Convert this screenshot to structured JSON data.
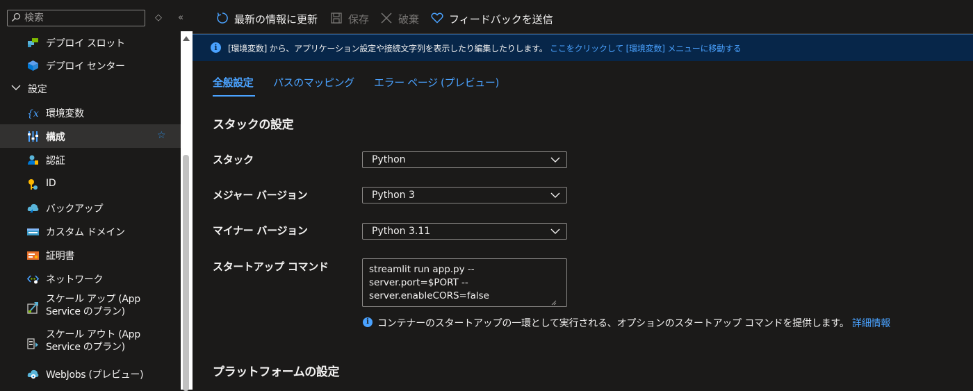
{
  "search": {
    "placeholder": "検索",
    "value": ""
  },
  "sidebar_controls": {
    "sort_glyph": "◇",
    "collapse_glyph": "«"
  },
  "sidebar": {
    "items": [
      {
        "label": "デプロイ スロット",
        "icon": "deployment-slots-icon"
      },
      {
        "label": "デプロイ センター",
        "icon": "deployment-center-icon"
      },
      {
        "label": "設定",
        "icon": "chevron-down-icon",
        "group": true
      },
      {
        "label": "環境変数",
        "icon": "environment-variables-icon"
      },
      {
        "label": "構成",
        "icon": "configuration-icon",
        "selected": true
      },
      {
        "label": "認証",
        "icon": "authentication-icon"
      },
      {
        "label": "ID",
        "icon": "identity-icon"
      },
      {
        "label": "バックアップ",
        "icon": "backup-icon"
      },
      {
        "label": "カスタム ドメイン",
        "icon": "custom-domain-icon"
      },
      {
        "label": "証明書",
        "icon": "certificate-icon"
      },
      {
        "label": "ネットワーク",
        "icon": "network-icon"
      },
      {
        "label": "スケール アップ (App Service のプラン)",
        "icon": "scale-up-icon"
      },
      {
        "label": "スケール アウト (App Service のプラン)",
        "icon": "scale-out-icon"
      },
      {
        "label": "WebJobs (プレビュー)",
        "icon": "webjobs-icon"
      }
    ],
    "favorite_glyph": "☆"
  },
  "toolbar": {
    "refresh_label": "最新の情報に更新",
    "save_label": "保存",
    "discard_label": "破棄",
    "feedback_label": "フィードバックを送信"
  },
  "infobar": {
    "text": "[環境変数] から、アプリケーション設定や接続文字列を表示したり編集したりします。",
    "link": "ここをクリックして [環境変数] メニューに移動する",
    "icon_glyph": "i"
  },
  "tabs": [
    {
      "label": "全般設定",
      "active": true
    },
    {
      "label": "パスのマッピング",
      "active": false
    },
    {
      "label": "エラー ページ (プレビュー)",
      "active": false
    }
  ],
  "stack_settings": {
    "title": "スタックの設定",
    "stack_label": "スタック",
    "stack_value": "Python",
    "major_label": "メジャー バージョン",
    "major_value": "Python 3",
    "minor_label": "マイナー バージョン",
    "minor_value": "Python 3.11",
    "startup_label": "スタートアップ コマンド",
    "startup_value": "streamlit run app.py --server.port=$PORT --server.enableCORS=false",
    "hint_text": "コンテナーのスタートアップの一環として実行される、オプションのスタートアップ コマンドを提供します。",
    "hint_link": "詳細情報",
    "hint_glyph": "i"
  },
  "platform_settings": {
    "title": "プラットフォームの設定"
  },
  "colors": {
    "accent": "#4aa2ff",
    "background": "#1b1a19",
    "infobar": "#072649",
    "selected": "#323130"
  }
}
